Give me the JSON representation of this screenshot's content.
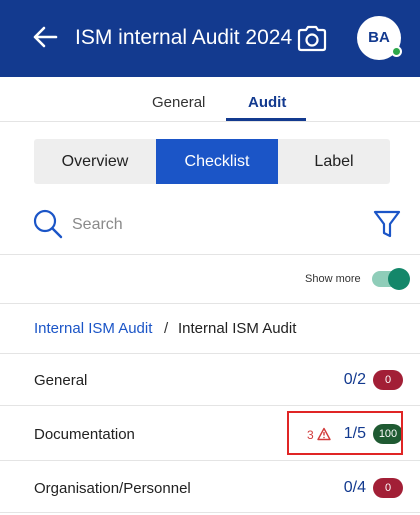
{
  "header": {
    "title": "ISM internal Audit 2024",
    "avatar_initials": "BA",
    "status_color": "#2ea84a",
    "background": "#133a8f",
    "icons": [
      "back-arrow-icon",
      "camera-icon"
    ]
  },
  "top_tabs": [
    {
      "label": "General",
      "active": false
    },
    {
      "label": "Audit",
      "active": true
    }
  ],
  "segments": [
    {
      "label": "Overview",
      "active": false
    },
    {
      "label": "Checklist",
      "active": true
    },
    {
      "label": "Label",
      "active": false
    }
  ],
  "search": {
    "placeholder": "Search",
    "value": ""
  },
  "show_more": {
    "label": "Show more",
    "enabled": true
  },
  "breadcrumb": {
    "link": "Internal ISM Audit",
    "separator": "/",
    "current": "Internal ISM Audit"
  },
  "rows": [
    {
      "label": "General",
      "count": "0/2",
      "badge": "0",
      "badge_color": "#a21f36"
    },
    {
      "label": "Documentation",
      "warnings": "3",
      "count": "1/5",
      "badge": "100",
      "badge_color": "#1f5a32",
      "highlighted": true
    },
    {
      "label": "Organisation/Personnel",
      "count": "0/4",
      "badge": "0",
      "badge_color": "#a21f36"
    }
  ]
}
